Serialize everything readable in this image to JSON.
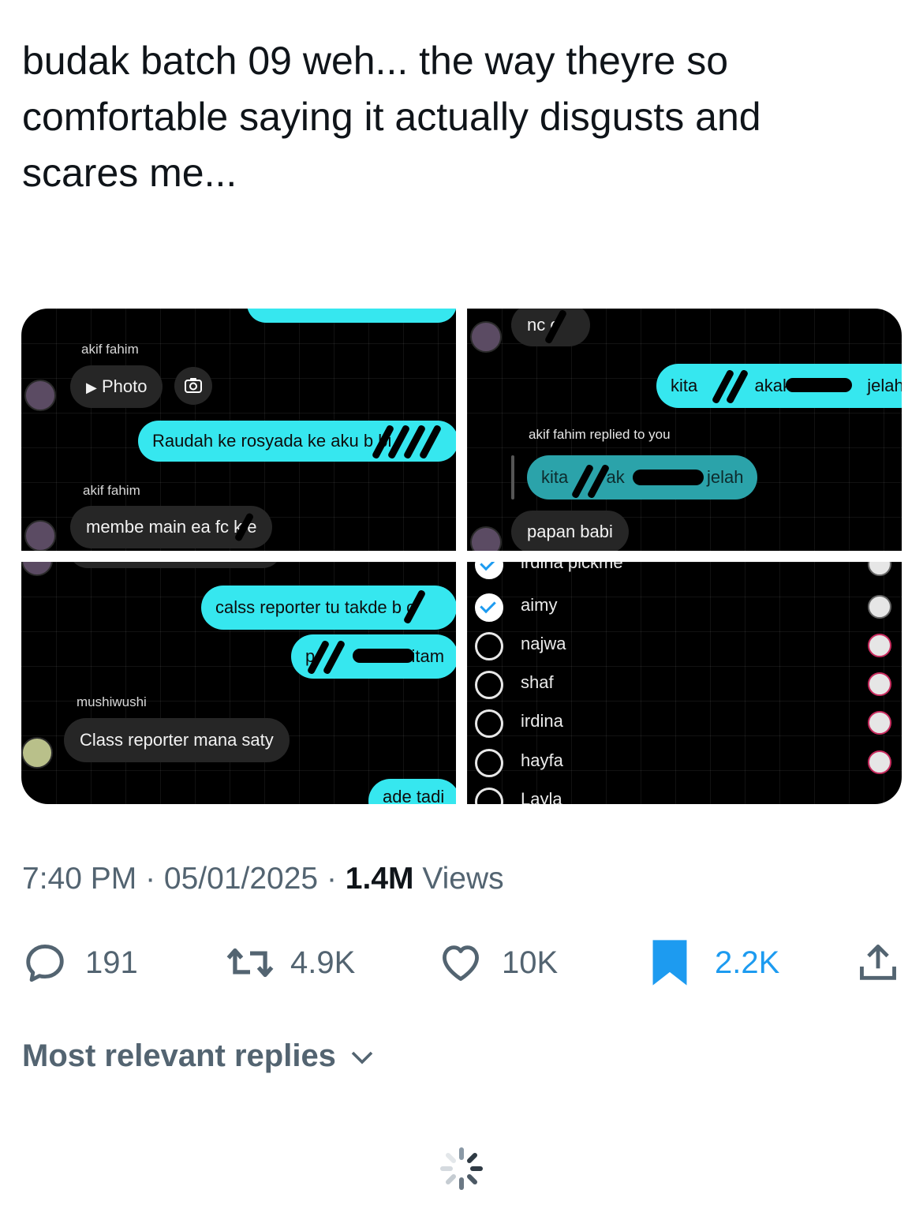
{
  "tweet": {
    "text_line1": "budak batch 09 weh... the way theyre so",
    "text_line2": "comfortable saying it actually disgusts and",
    "text_line3": "scares me..."
  },
  "panel1": {
    "sender1": "akif fahim",
    "photo_label": "Photo",
    "outgoing": "Raudah ke rosyada ke aku",
    "outgoing_tail": "b  bi",
    "sender2": "akif fahim",
    "incoming": "membe main ea fc k  e"
  },
  "panel2": {
    "top_bubble": "nc  o",
    "out_start": "kita",
    "out_mid": "akak",
    "out_end": "jelah",
    "reply_label": "akif fahim replied to you",
    "quoted_start": "kita",
    "quoted_mid": "ak",
    "quoted_end": "jelah",
    "incoming": "papan babi"
  },
  "panel3": {
    "out1": "calss reporter tu takde b  o",
    "out2_start": "p",
    "out2_end": "itam",
    "sender": "mushiwushi",
    "incoming": "Class reporter mana saty",
    "out3": "ade tadi"
  },
  "panel4": {
    "items": [
      {
        "label": "irdina pickme",
        "checked": true
      },
      {
        "label": "aimy",
        "checked": true
      },
      {
        "label": "najwa",
        "checked": false
      },
      {
        "label": "shaf",
        "checked": false
      },
      {
        "label": "irdina",
        "checked": false
      },
      {
        "label": "hayfa",
        "checked": false
      },
      {
        "label": "Layla",
        "checked": false
      }
    ]
  },
  "meta": {
    "time": "7:40 PM",
    "sep1": " · ",
    "date": "05/01/2025",
    "sep2": " · ",
    "views_count": "1.4M",
    "views_label": " Views"
  },
  "actions": {
    "replies": "191",
    "reposts": "4.9K",
    "likes": "10K",
    "bookmarks": "2.2K"
  },
  "replies_header": "Most relevant replies",
  "icons": {
    "reply": "reply-icon",
    "repost": "repost-icon",
    "like": "heart-icon",
    "bookmark": "bookmark-icon",
    "share": "share-icon",
    "chevron": "chevron-down-icon",
    "spinner": "loading-spinner-icon"
  },
  "colors": {
    "bubble_out": "#36e7ef",
    "bookmark_active": "#1d9bf0",
    "muted": "#536471"
  }
}
